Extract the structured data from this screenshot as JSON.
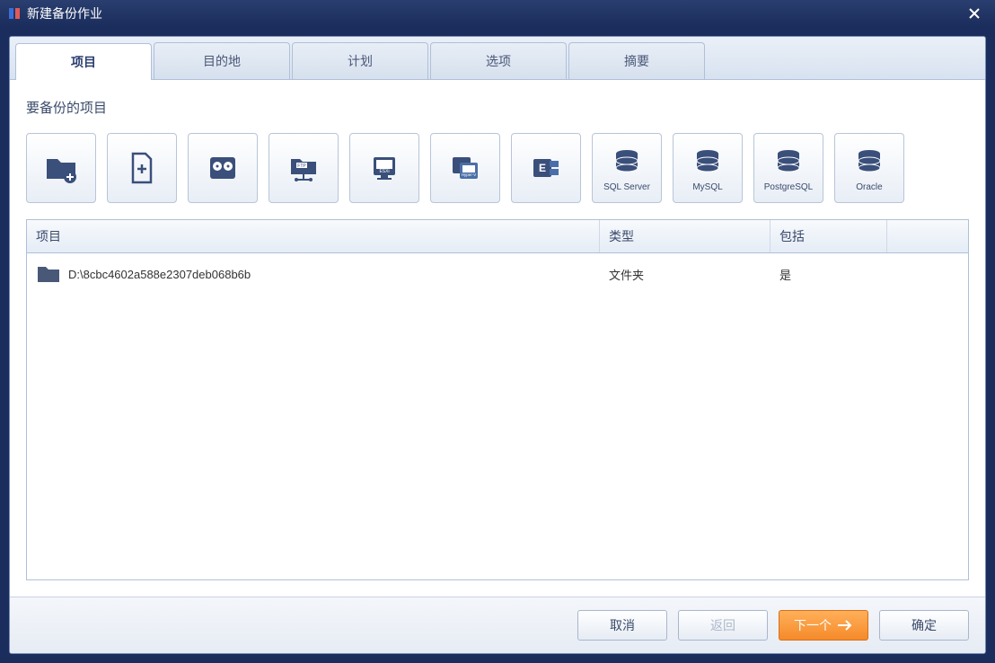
{
  "window": {
    "title": "新建备份作业"
  },
  "tabs": [
    {
      "label": "项目",
      "active": true
    },
    {
      "label": "目的地",
      "active": false
    },
    {
      "label": "计划",
      "active": false
    },
    {
      "label": "选项",
      "active": false
    },
    {
      "label": "摘要",
      "active": false
    }
  ],
  "section_heading": "要备份的项目",
  "source_buttons": [
    {
      "name": "add-folder",
      "label": ""
    },
    {
      "name": "add-file",
      "label": ""
    },
    {
      "name": "add-disk",
      "label": ""
    },
    {
      "name": "add-ftp",
      "label": ""
    },
    {
      "name": "add-esxi",
      "label": ""
    },
    {
      "name": "add-hyperv",
      "label": ""
    },
    {
      "name": "add-exchange",
      "label": ""
    },
    {
      "name": "add-sqlserver",
      "label": "SQL Server"
    },
    {
      "name": "add-mysql",
      "label": "MySQL"
    },
    {
      "name": "add-postgresql",
      "label": "PostgreSQL"
    },
    {
      "name": "add-oracle",
      "label": "Oracle"
    }
  ],
  "columns": {
    "item": "项目",
    "type": "类型",
    "include": "包括"
  },
  "rows": [
    {
      "path": "D:\\8cbc4602a588e2307deb068b6b",
      "type": "文件夹",
      "include": "是"
    }
  ],
  "footer": {
    "cancel": "取消",
    "back": "返回",
    "next": "下一个",
    "ok": "确定"
  }
}
